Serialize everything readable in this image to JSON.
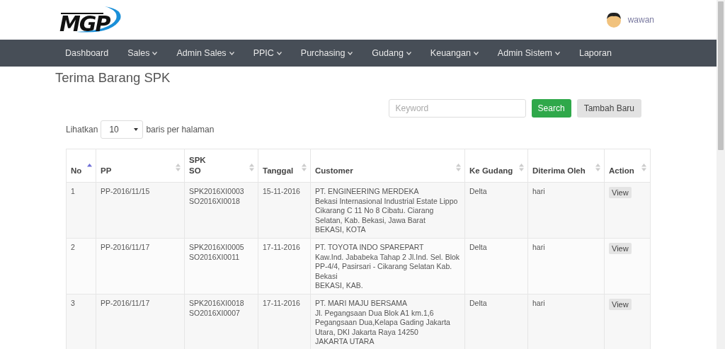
{
  "header": {
    "logo": "MGP",
    "user": "wawan"
  },
  "nav": [
    {
      "label": "Dashboard",
      "dropdown": false
    },
    {
      "label": "Sales",
      "dropdown": true
    },
    {
      "label": "Admin Sales",
      "dropdown": true
    },
    {
      "label": "PPIC",
      "dropdown": true
    },
    {
      "label": "Purchasing",
      "dropdown": true
    },
    {
      "label": "Gudang",
      "dropdown": true
    },
    {
      "label": "Keuangan",
      "dropdown": true
    },
    {
      "label": "Admin Sistem",
      "dropdown": true
    },
    {
      "label": "Laporan",
      "dropdown": false
    }
  ],
  "page_title": "Terima Barang SPK",
  "search": {
    "placeholder": "Keyword",
    "button": "Search",
    "add_button": "Tambah Baru"
  },
  "page_size": {
    "before": "Lihatkan",
    "value": "10",
    "after": "baris per halaman"
  },
  "table": {
    "columns": [
      {
        "lines": [
          "No"
        ],
        "sorted": true
      },
      {
        "lines": [
          "PP"
        ],
        "sorted": false
      },
      {
        "lines": [
          "SPK",
          "SO"
        ],
        "sorted": false
      },
      {
        "lines": [
          "Tanggal"
        ],
        "sorted": false
      },
      {
        "lines": [
          "Customer"
        ],
        "sorted": false
      },
      {
        "lines": [
          "Ke Gudang"
        ],
        "sorted": false
      },
      {
        "lines": [
          "Diterima Oleh"
        ],
        "sorted": false
      },
      {
        "lines": [
          "Action"
        ],
        "sorted": false
      }
    ],
    "rows": [
      {
        "no": "1",
        "pp": "PP-2016/11/15",
        "spk": "SPK2016XI0003",
        "so": "SO2016XI0018",
        "tanggal": "15-11-2016",
        "customer": [
          "PT. ENGINEERING MERDEKA",
          "Bekasi Internasional Industrial Estate Lippo Cikarang C 11 No 8 Cibatu. Ciarang Selatan, Kab. Bekasi, Jawa Barat",
          "BEKASI, KOTA"
        ],
        "gudang": "Delta",
        "diterima": "hari",
        "action": "View"
      },
      {
        "no": "2",
        "pp": "PP-2016/11/17",
        "spk": "SPK2016XI0005",
        "so": "SO2016XI0011",
        "tanggal": "17-11-2016",
        "customer": [
          "PT. TOYOTA INDO SPAREPART",
          "Kaw.Ind. Jababeka Tahap 2 Jl.Ind. Sel. Blok PP-4/4, Pasirsari - Cikarang Selatan Kab. Bekasi",
          "BEKASI, KAB."
        ],
        "gudang": "Delta",
        "diterima": "hari",
        "action": "View"
      },
      {
        "no": "3",
        "pp": "PP-2016/11/17",
        "spk": "SPK2016XI0018",
        "so": "SO2016XI0007",
        "tanggal": "17-11-2016",
        "customer": [
          "PT. MARI MAJU BERSAMA",
          "Jl. Pegangsaan Dua Blok A1 km.1,6 Pegangsaan Dua,Kelapa Gading Jakarta Utara, DKI Jakarta Raya 14250",
          "JAKARTA UTARA"
        ],
        "gudang": "Delta",
        "diterima": "hari",
        "action": "View"
      }
    ]
  }
}
